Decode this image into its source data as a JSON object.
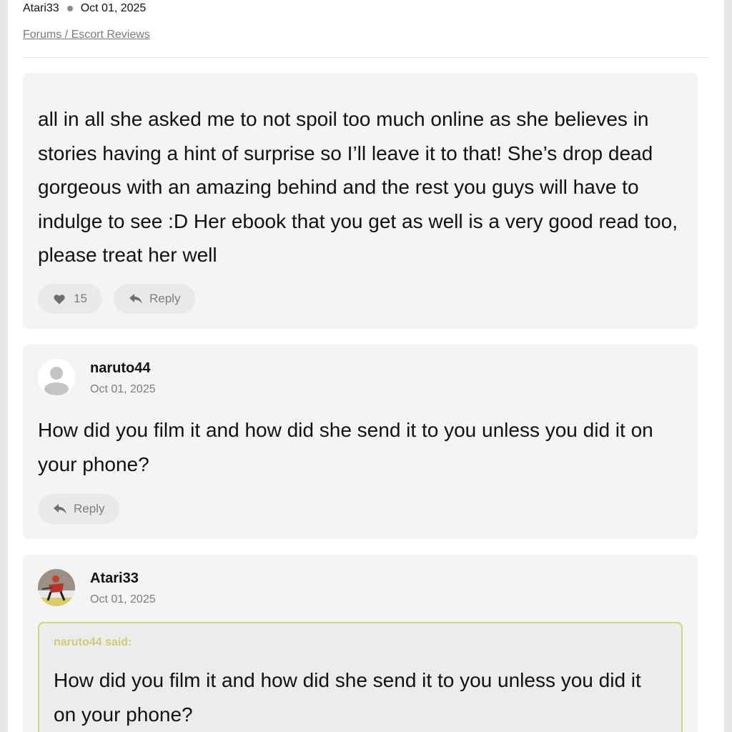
{
  "header": {
    "author": "Atari33",
    "date": "Oct 01, 2025",
    "breadcrumb": "Forums / Escort Reviews"
  },
  "posts": [
    {
      "body": "all in all she asked me to not spoil too much online as she believes in stories having a hint of surprise so I’ll leave it to that! She’s drop dead gorgeous with an amazing behind and the rest you guys will have to indulge to see :D Her ebook that you get as well is a very good read too, please treat her well",
      "likes": "15",
      "reply_label": "Reply"
    },
    {
      "author": "naruto44",
      "date": "Oct 01, 2025",
      "body": "How did you film it and how did she send it to you unless you did it on your phone?",
      "reply_label": "Reply"
    },
    {
      "author": "Atari33",
      "date": "Oct 01, 2025",
      "quote_author": "naruto44 said:",
      "quote_body": "How did you film it and how did she send it to you unless you did it on your phone?"
    }
  ],
  "icons": {
    "like": "heart-icon",
    "reply": "reply-arrow-icon",
    "default_avatar": "user-silhouette-icon"
  },
  "colors": {
    "card_bg": "#f4f4f4",
    "quote_border": "#d9d27e",
    "quote_author": "#d1cb74",
    "muted_text": "#7d7d7d"
  }
}
